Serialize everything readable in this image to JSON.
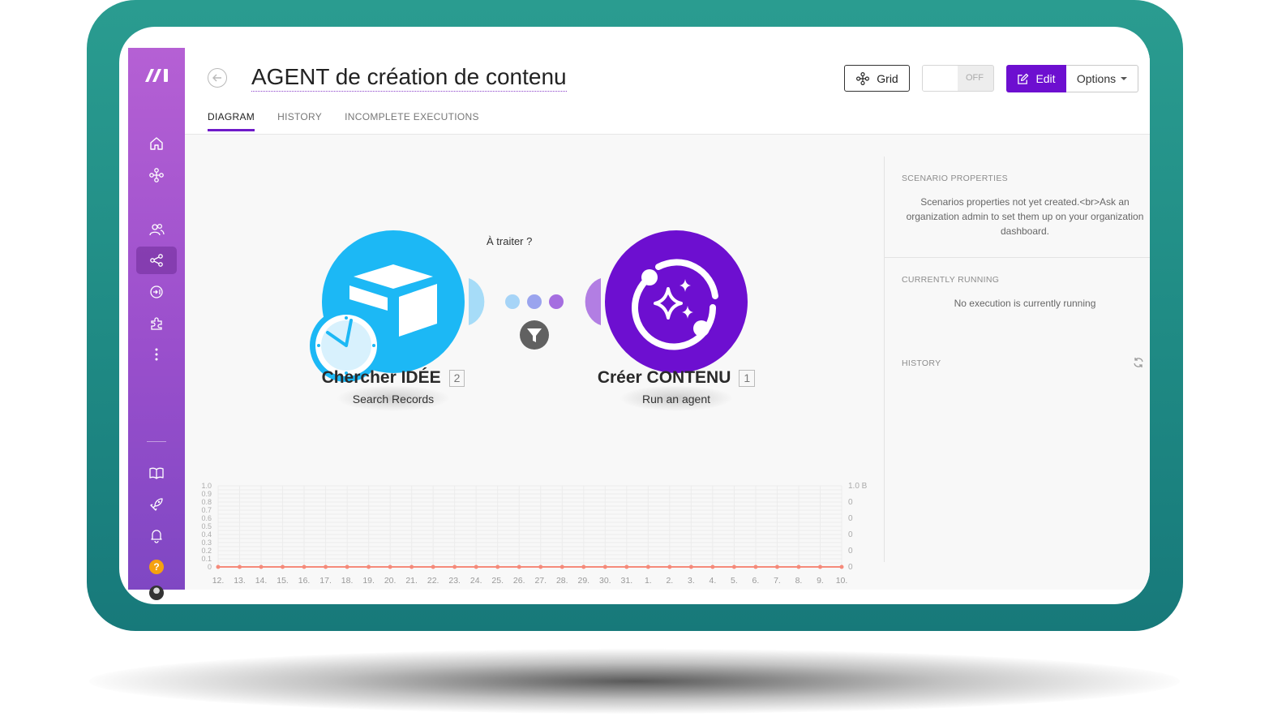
{
  "app": {
    "title": "AGENT de création de contenu",
    "tabs": [
      {
        "label": "DIAGRAM",
        "active": true
      },
      {
        "label": "HISTORY",
        "active": false
      },
      {
        "label": "INCOMPLETE EXECUTIONS",
        "active": false
      }
    ]
  },
  "toolbar": {
    "grid_label": "Grid",
    "toggle_label": "OFF",
    "edit_label": "Edit",
    "options_label": "Options"
  },
  "colors": {
    "brand": "#6d0fd0",
    "sidebar_top": "#b560d4",
    "sidebar_bottom": "#7f47c3",
    "module_airtable": "#1cb8f5",
    "module_agent": "#6d0fd0",
    "chart_line": "#f58a7a"
  },
  "sidebar": {
    "items": [
      {
        "icon": "home-icon"
      },
      {
        "icon": "templates-icon"
      },
      {
        "icon": "team-icon"
      },
      {
        "icon": "scenarios-icon",
        "active": true
      },
      {
        "icon": "connections-icon"
      },
      {
        "icon": "apps-icon"
      },
      {
        "icon": "more-icon"
      },
      {
        "icon": "docs-icon"
      },
      {
        "icon": "launch-icon"
      },
      {
        "icon": "notifications-icon"
      },
      {
        "icon": "help-icon",
        "label": "?"
      },
      {
        "icon": "avatar"
      }
    ]
  },
  "diagram": {
    "modules": [
      {
        "name": "Chercher IDÉE",
        "badge": "2",
        "subtitle": "Search Records",
        "icon": "airtable-icon"
      },
      {
        "name": "Créer CONTENU",
        "badge": "1",
        "subtitle": "Run an agent",
        "icon": "ai-agent-icon"
      }
    ],
    "connection_label": "À traiter ?"
  },
  "right_panel": {
    "scenario_properties": {
      "heading": "SCENARIO PROPERTIES",
      "text": "Scenarios properties not yet created.<br>Ask an organization admin to set them up on your organization dashboard."
    },
    "currently_running": {
      "heading": "CURRENTLY RUNNING",
      "text": "No execution is currently running"
    },
    "history": {
      "heading": "HISTORY"
    }
  },
  "chart_data": {
    "type": "line",
    "x": [
      "12.",
      "13.",
      "14.",
      "15.",
      "16.",
      "17.",
      "18.",
      "19.",
      "20.",
      "21.",
      "22.",
      "23.",
      "24.",
      "25.",
      "26.",
      "27.",
      "28.",
      "29.",
      "30.",
      "31.",
      "1.",
      "2.",
      "3.",
      "4.",
      "5.",
      "6.",
      "7.",
      "8.",
      "9.",
      "10."
    ],
    "series": [
      {
        "values": [
          0,
          0,
          0,
          0,
          0,
          0,
          0,
          0,
          0,
          0,
          0,
          0,
          0,
          0,
          0,
          0,
          0,
          0,
          0,
          0,
          0,
          0,
          0,
          0,
          0,
          0,
          0,
          0,
          0,
          0
        ]
      }
    ],
    "left_ticks": [
      "0",
      "0.1",
      "0.2",
      "0.3",
      "0.4",
      "0.5",
      "0.6",
      "0.7",
      "0.8",
      "0.9",
      "1.0"
    ],
    "right_ticks": [
      "0",
      "0",
      "0",
      "0",
      "0",
      "1.0 B"
    ],
    "ylim": [
      0,
      1.0
    ],
    "grid": true
  }
}
